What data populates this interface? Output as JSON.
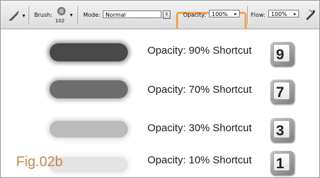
{
  "toolbar": {
    "brush_label": "Brush:",
    "brush_size": "102",
    "mode_label": "Mode:",
    "mode_value": "Normal",
    "opacity_label": "Opacity:",
    "opacity_value": "100%",
    "flow_label": "Flow:",
    "flow_value": "100%"
  },
  "rows": [
    {
      "label": "Opacity: 90% Shortcut",
      "key": "9",
      "opacity": 0.9
    },
    {
      "label": "Opacity: 70% Shortcut",
      "key": "7",
      "opacity": 0.7
    },
    {
      "label": "Opacity: 30% Shortcut",
      "key": "3",
      "opacity": 0.3
    },
    {
      "label": "Opacity: 10% Shortcut",
      "key": "1",
      "opacity": 0.1
    }
  ],
  "figure_label": "Fig.02b",
  "colors": {
    "highlight": "#f5a54c",
    "figure_label": "#c6884a",
    "stroke": "#404040"
  },
  "icons": {
    "tool": "brush-tool-icon",
    "airbrush": "airbrush-icon"
  }
}
